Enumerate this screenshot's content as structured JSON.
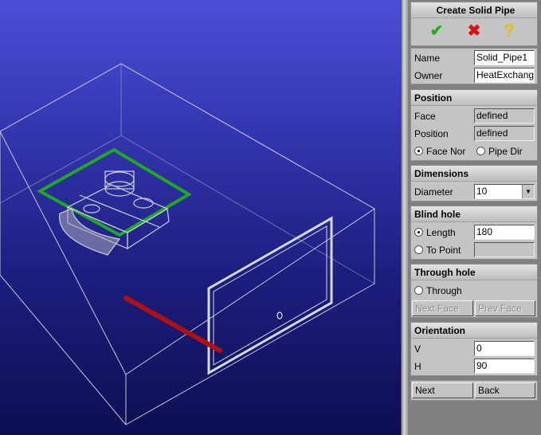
{
  "dialog": {
    "title": "Create Solid Pipe",
    "ok_icon": "check-icon",
    "cancel_icon": "cross-icon",
    "help_icon": "question-icon",
    "ok_glyph": "✔",
    "cancel_glyph": "✖",
    "help_glyph": "?"
  },
  "general": {
    "name_label": "Name",
    "name_value": "Solid_Pipe1",
    "owner_label": "Owner",
    "owner_value": "HeatExchange"
  },
  "position": {
    "title": "Position",
    "face_label": "Face",
    "face_value": "defined",
    "position_label": "Position",
    "position_value": "defined",
    "radio_face_normal": "Face Nor",
    "radio_pipe_dir": "Pipe Dir",
    "selected": "face_normal"
  },
  "dimensions": {
    "title": "Dimensions",
    "diameter_label": "Diameter",
    "diameter_value": "10"
  },
  "blind_hole": {
    "title": "Blind hole",
    "length_label": "Length",
    "length_value": "180",
    "to_point_label": "To Point",
    "to_point_value": "",
    "selected": "length"
  },
  "through_hole": {
    "title": "Through hole",
    "through_label": "Through",
    "next_face_label": "Next Face",
    "prev_face_label": "Prev Face"
  },
  "orientation": {
    "title": "Orientation",
    "v_label": "V",
    "v_value": "0",
    "h_label": "H",
    "h_value": "90"
  },
  "footer": {
    "next_label": "Next",
    "back_label": "Back"
  },
  "colors": {
    "viewport_top": "#4a4fd6",
    "viewport_bottom": "#0d0e52",
    "wireframe": "#c8c8d8",
    "selected_face": "#1faa1f",
    "pipe": "#b01010",
    "ok_icon": "#22aa22",
    "cancel_icon": "#dd1111",
    "help_icon": "#e0c000"
  }
}
